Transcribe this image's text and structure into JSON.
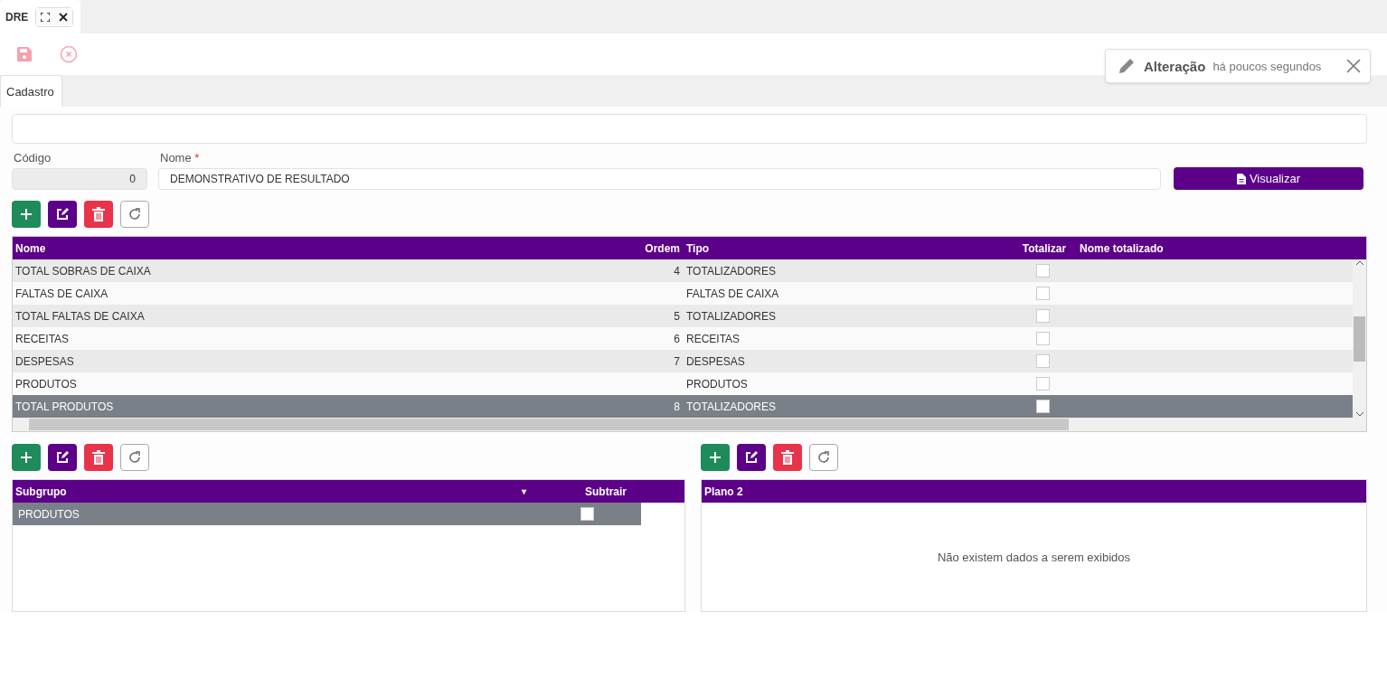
{
  "doc_tabs": [
    {
      "label": "DRE",
      "selected": true
    }
  ],
  "toolbar": {
    "save_disabled": true,
    "cancel_disabled": true
  },
  "toast": {
    "title": "Alteração",
    "time": "há poucos segundos"
  },
  "form_tabs": [
    {
      "label": "Cadastro",
      "selected": true
    }
  ],
  "fields": {
    "codigo": {
      "label": "Código",
      "value": "0"
    },
    "nome": {
      "label": "Nome",
      "required_mark": "*",
      "value": "DEMONSTRATIVO DE RESULTADO"
    },
    "view_button": "Visualizar"
  },
  "grid": {
    "columns": [
      "Nome",
      "Ordem",
      "Tipo",
      "Totalizar",
      "Nome totalizado"
    ],
    "rows": [
      {
        "nome": "TOTAL SOBRAS DE CAIXA",
        "ordem": "4",
        "tipo": "TOTALIZADORES",
        "totalizar": false,
        "selected": false
      },
      {
        "nome": "FALTAS DE CAIXA",
        "ordem": "",
        "tipo": "FALTAS DE CAIXA",
        "totalizar": false,
        "selected": false
      },
      {
        "nome": "TOTAL FALTAS DE CAIXA",
        "ordem": "5",
        "tipo": "TOTALIZADORES",
        "totalizar": false,
        "selected": false
      },
      {
        "nome": "RECEITAS",
        "ordem": "6",
        "tipo": "RECEITAS",
        "totalizar": false,
        "selected": false
      },
      {
        "nome": "DESPESAS",
        "ordem": "7",
        "tipo": "DESPESAS",
        "totalizar": false,
        "selected": false
      },
      {
        "nome": "PRODUTOS",
        "ordem": "",
        "tipo": "PRODUTOS",
        "totalizar": false,
        "selected": false
      },
      {
        "nome": "TOTAL PRODUTOS",
        "ordem": "8",
        "tipo": "TOTALIZADORES",
        "totalizar": false,
        "selected": true
      }
    ]
  },
  "subgroup_grid": {
    "columns": [
      "Subgrupo",
      "Subtrair"
    ],
    "sort_icon": "▾",
    "rows": [
      {
        "subgrupo": "PRODUTOS",
        "subtrair": false,
        "selected": true
      }
    ]
  },
  "plan_grid": {
    "columns": [
      "Plano 2"
    ],
    "empty_text": "Não existem dados a serem exibidos"
  }
}
